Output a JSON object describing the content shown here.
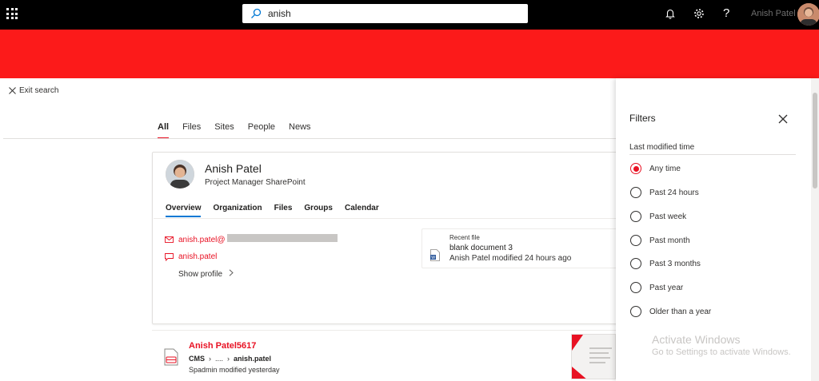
{
  "topbar": {
    "search_value": "anish",
    "help_label": "?",
    "user_name": "Anish Patel"
  },
  "nav": {
    "exit_search": "Exit search",
    "tabs": [
      {
        "label": "All",
        "active": true
      },
      {
        "label": "Files",
        "active": false
      },
      {
        "label": "Sites",
        "active": false
      },
      {
        "label": "People",
        "active": false
      },
      {
        "label": "News",
        "active": false
      }
    ]
  },
  "person": {
    "name": "Anish Patel",
    "title": "Project Manager SharePoint",
    "tabs": [
      "Overview",
      "Organization",
      "Files",
      "Groups",
      "Calendar"
    ],
    "email": "anish.patel@",
    "chat": "anish.patel",
    "show_profile": "Show profile",
    "recent": {
      "label": "Recent file",
      "name": "blank document 3",
      "meta": "Anish Patel modified 24 hours ago"
    }
  },
  "result": {
    "title": "Anish Patel5617",
    "path": [
      "CMS",
      "....",
      "anish.patel"
    ],
    "modified": "Spadmin modified yesterday"
  },
  "filters": {
    "title": "Filters",
    "section": "Last modified time",
    "options": [
      {
        "label": "Any time",
        "checked": true
      },
      {
        "label": "Past 24 hours",
        "checked": false
      },
      {
        "label": "Past week",
        "checked": false
      },
      {
        "label": "Past month",
        "checked": false
      },
      {
        "label": "Past 3 months",
        "checked": false
      },
      {
        "label": "Past year",
        "checked": false
      },
      {
        "label": "Older than a year",
        "checked": false
      }
    ]
  },
  "watermark": {
    "line1": "Activate Windows",
    "line2": "Go to Settings to activate Windows."
  },
  "colors": {
    "accent": "#e81123",
    "banner": "#fc1a1a",
    "topbar": "#000000"
  }
}
